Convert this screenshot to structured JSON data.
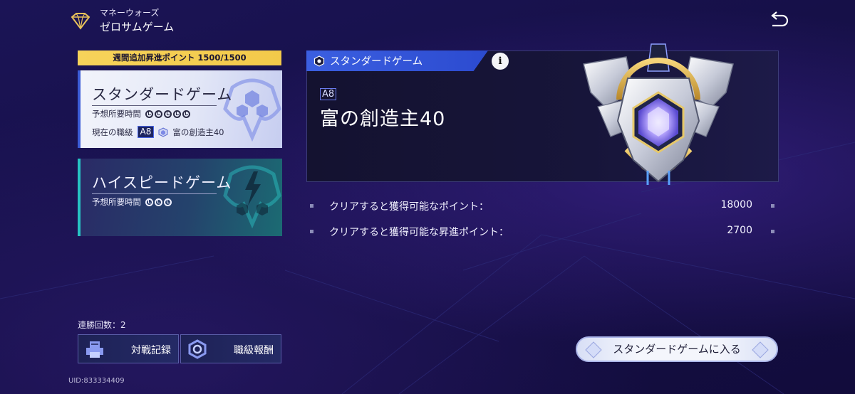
{
  "header": {
    "subtitle": "マネーウォーズ",
    "title": "ゼロサムゲーム"
  },
  "sidebar": {
    "weekly_label": "週間追加昇進ポイント 1500/1500",
    "standard": {
      "title": "スタンダードゲーム",
      "time_label": "予想所要時間",
      "time_icons": 5,
      "rank_label": "現在の職級",
      "rank_code": "A8",
      "rank_name": "富の創造主40"
    },
    "highspeed": {
      "title": "ハイスピードゲーム",
      "time_label": "予想所要時間",
      "time_icons": 3
    }
  },
  "panel": {
    "tag": "スタンダードゲーム",
    "info": "i",
    "rank_code": "A8",
    "rank_name": "富の創造主40"
  },
  "points": [
    {
      "label": "クリアすると獲得可能なポイント：",
      "value": "18000"
    },
    {
      "label": "クリアすると獲得可能な昇進ポイント：",
      "value": "2700"
    }
  ],
  "footer": {
    "streak": "連勝回数：2",
    "history_button": "対戦記録",
    "rank_reward_button": "職級報酬",
    "uid": "UID:833334409",
    "enter_button": "スタンダードゲームに入る"
  },
  "colors": {
    "accent_blue": "#3b5fe0",
    "gold": "#f6d35a",
    "teal": "#27c3c3"
  }
}
